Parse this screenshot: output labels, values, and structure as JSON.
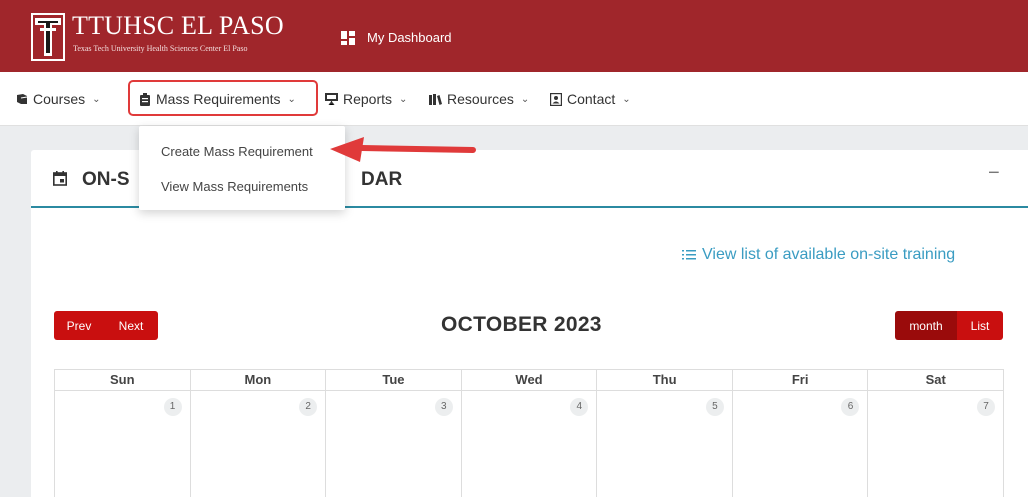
{
  "header": {
    "brand_title": "TTUHSC EL PASO",
    "brand_subtitle": "Texas Tech University Health Sciences Center El Paso",
    "dashboard_link": "My Dashboard",
    "bg_color": "#a0262b"
  },
  "nav": {
    "items": [
      {
        "label": "Courses",
        "icon": "book-icon"
      },
      {
        "label": "Mass Requirements",
        "icon": "clipboard-icon"
      },
      {
        "label": "Reports",
        "icon": "presentation-icon"
      },
      {
        "label": "Resources",
        "icon": "library-icon"
      },
      {
        "label": "Contact",
        "icon": "contact-card-icon"
      }
    ]
  },
  "dropdown": {
    "items": [
      "Create Mass Requirement",
      "View Mass Requirements"
    ]
  },
  "card": {
    "title_left": "ON-S",
    "title_right": "DAR",
    "collapse_symbol": "−",
    "list_link": "View list of available on-site training"
  },
  "calendar": {
    "title": "OCTOBER 2023",
    "prev_label": "Prev",
    "next_label": "Next",
    "month_label": "month",
    "list_label": "List",
    "weekdays": [
      "Sun",
      "Mon",
      "Tue",
      "Wed",
      "Thu",
      "Fri",
      "Sat"
    ],
    "first_week": [
      "1",
      "2",
      "3",
      "4",
      "5",
      "6",
      "7"
    ],
    "button_color": "#c90f0f",
    "accent_color": "#2b8aa1"
  }
}
